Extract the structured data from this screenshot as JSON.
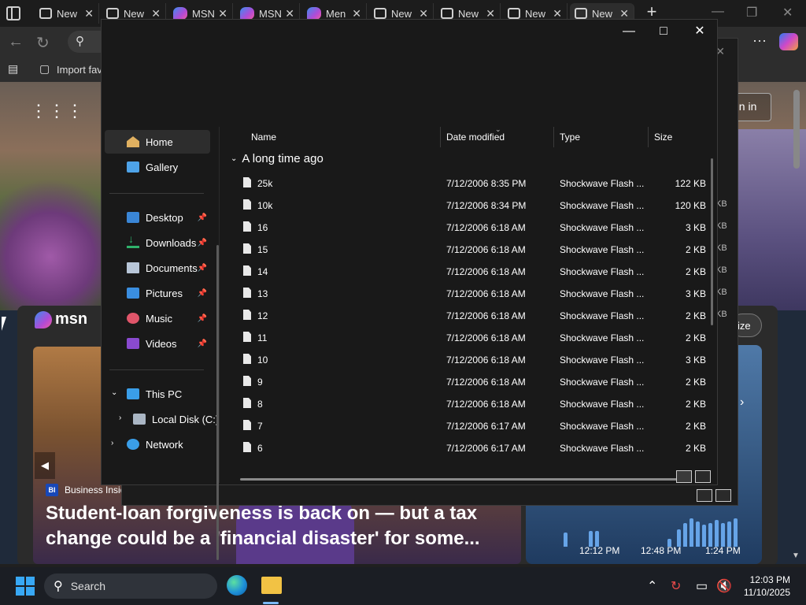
{
  "browser": {
    "tabs": [
      {
        "label": "New",
        "icon": "tab-page-icon"
      },
      {
        "label": "New",
        "icon": "tab-page-icon"
      },
      {
        "label": "MSN",
        "icon": "msn-icon"
      },
      {
        "label": "MSN",
        "icon": "msn-icon"
      },
      {
        "label": "Men",
        "icon": "msn-icon"
      },
      {
        "label": "New",
        "icon": "tab-page-icon"
      },
      {
        "label": "New",
        "icon": "tab-page-icon"
      },
      {
        "label": "New",
        "icon": "tab-page-icon"
      },
      {
        "label": "New",
        "icon": "tab-page-icon"
      }
    ],
    "favorites_import_label": "Import fav"
  },
  "msn": {
    "logo_text": "msn",
    "signin_label": "gn in",
    "size_label": "ize",
    "news_source": "Business Insid",
    "headline": "Student-loan forgiveness is back on — but a tax change could be a 'financial disaster' for some...",
    "weather_times": [
      "12:12 PM",
      "12:48 PM",
      "1:24 PM"
    ]
  },
  "explorer": {
    "nav": {
      "home": "Home",
      "gallery": "Gallery",
      "desktop": "Desktop",
      "downloads": "Downloads",
      "documents": "Documents",
      "pictures": "Pictures",
      "music": "Music",
      "videos": "Videos",
      "this_pc": "This PC",
      "local_disk": "Local Disk (C:)",
      "network": "Network"
    },
    "columns": {
      "name": "Name",
      "date": "Date modified",
      "type": "Type",
      "size": "Size"
    },
    "group_label": "A long time ago",
    "files": [
      {
        "name": "25k",
        "date": "7/12/2006 8:35 PM",
        "type": "Shockwave Flash ...",
        "size": "122 KB"
      },
      {
        "name": "10k",
        "date": "7/12/2006 8:34 PM",
        "type": "Shockwave Flash ...",
        "size": "120 KB"
      },
      {
        "name": "16",
        "date": "7/12/2006 6:18 AM",
        "type": "Shockwave Flash ...",
        "size": "3 KB"
      },
      {
        "name": "15",
        "date": "7/12/2006 6:18 AM",
        "type": "Shockwave Flash ...",
        "size": "2 KB"
      },
      {
        "name": "14",
        "date": "7/12/2006 6:18 AM",
        "type": "Shockwave Flash ...",
        "size": "2 KB"
      },
      {
        "name": "13",
        "date": "7/12/2006 6:18 AM",
        "type": "Shockwave Flash ...",
        "size": "3 KB"
      },
      {
        "name": "12",
        "date": "7/12/2006 6:18 AM",
        "type": "Shockwave Flash ...",
        "size": "2 KB"
      },
      {
        "name": "11",
        "date": "7/12/2006 6:18 AM",
        "type": "Shockwave Flash ...",
        "size": "2 KB"
      },
      {
        "name": "10",
        "date": "7/12/2006 6:18 AM",
        "type": "Shockwave Flash ...",
        "size": "3 KB"
      },
      {
        "name": "9",
        "date": "7/12/2006 6:18 AM",
        "type": "Shockwave Flash ...",
        "size": "2 KB"
      },
      {
        "name": "8",
        "date": "7/12/2006 6:18 AM",
        "type": "Shockwave Flash ...",
        "size": "2 KB"
      },
      {
        "name": "7",
        "date": "7/12/2006 6:17 AM",
        "type": "Shockwave Flash ...",
        "size": "2 KB"
      },
      {
        "name": "6",
        "date": "7/12/2006 6:17 AM",
        "type": "Shockwave Flash ...",
        "size": "2 KB"
      }
    ],
    "bg_window_sizes": [
      "KB",
      "KB",
      "KB",
      "KB",
      "KB",
      "KB",
      "KB",
      "KB"
    ]
  },
  "taskbar": {
    "search_label": "Search",
    "time": "12:03 PM",
    "date": "11/10/2025"
  },
  "colors": {
    "accent": "#38a8f5",
    "explorer_bg": "#191919",
    "selected_nav": "#2d2d2d"
  }
}
